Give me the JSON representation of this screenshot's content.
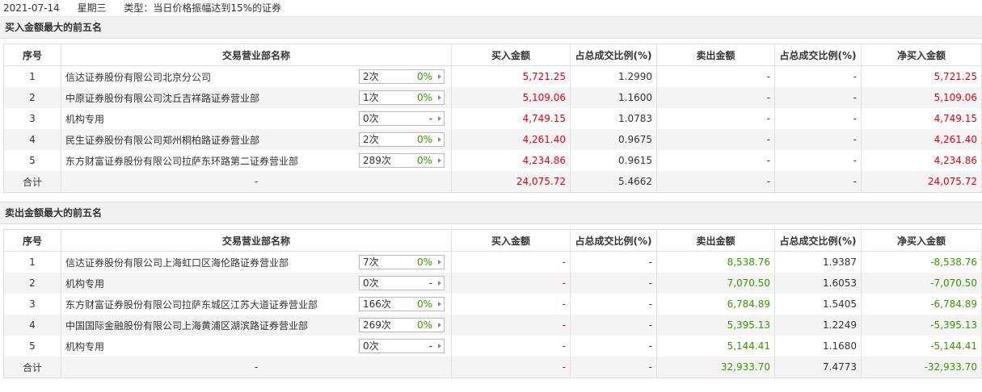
{
  "header": {
    "date": "2021-07-14",
    "weekday": "星期三",
    "type_text": "类型：当日价格振幅达到15%的证券"
  },
  "columns": [
    "序号",
    "交易营业部名称",
    "买入金额",
    "占总成交比例(%)",
    "卖出金额",
    "占总成交比例(%)",
    "净买入金额"
  ],
  "colors": {
    "up": "#e60012",
    "down": "#339900",
    "section_bg": "#f1f1f1",
    "stripe": "#f4f4f4"
  },
  "buy_section": {
    "title": "买入金额最大的前五名",
    "rows": [
      {
        "no": "1",
        "name": "信达证券股份有限公司北京分公司",
        "count": "2次",
        "pct": "0%",
        "buy": "5,721.25",
        "buy_ratio": "1.2990",
        "sell": "-",
        "sell_ratio": "-",
        "net": "5,721.25"
      },
      {
        "no": "2",
        "name": "中原证券股份有限公司沈丘吉祥路证券营业部",
        "count": "1次",
        "pct": "0%",
        "buy": "5,109.06",
        "buy_ratio": "1.1600",
        "sell": "-",
        "sell_ratio": "-",
        "net": "5,109.06"
      },
      {
        "no": "3",
        "name": "机构专用",
        "count": "0次",
        "pct": "-",
        "buy": "4,749.15",
        "buy_ratio": "1.0783",
        "sell": "-",
        "sell_ratio": "-",
        "net": "4,749.15"
      },
      {
        "no": "4",
        "name": "民生证券股份有限公司郑州桐柏路证券营业部",
        "count": "2次",
        "pct": "0%",
        "buy": "4,261.40",
        "buy_ratio": "0.9675",
        "sell": "-",
        "sell_ratio": "-",
        "net": "4,261.40"
      },
      {
        "no": "5",
        "name": "东方财富证券股份有限公司拉萨东环路第二证券营业部",
        "count": "289次",
        "pct": "0%",
        "buy": "4,234.86",
        "buy_ratio": "0.9615",
        "sell": "-",
        "sell_ratio": "-",
        "net": "4,234.86"
      }
    ],
    "total": {
      "label": "合计",
      "name": "-",
      "buy": "24,075.72",
      "buy_ratio": "5.4662",
      "sell": "-",
      "sell_ratio": "-",
      "net": "24,075.72"
    }
  },
  "sell_section": {
    "title": "卖出金额最大的前五名",
    "rows": [
      {
        "no": "1",
        "name": "信达证券股份有限公司上海虹口区海伦路证券营业部",
        "count": "7次",
        "pct": "0%",
        "buy": "-",
        "buy_ratio": "-",
        "sell": "8,538.76",
        "sell_ratio": "1.9387",
        "net": "-8,538.76"
      },
      {
        "no": "2",
        "name": "机构专用",
        "count": "0次",
        "pct": "-",
        "buy": "-",
        "buy_ratio": "-",
        "sell": "7,070.50",
        "sell_ratio": "1.6053",
        "net": "-7,070.50"
      },
      {
        "no": "3",
        "name": "东方财富证券股份有限公司拉萨东城区江苏大道证券营业部",
        "count": "166次",
        "pct": "0%",
        "buy": "-",
        "buy_ratio": "-",
        "sell": "6,784.89",
        "sell_ratio": "1.5405",
        "net": "-6,784.89"
      },
      {
        "no": "4",
        "name": "中国国际金融股份有限公司上海黄浦区湖滨路证券营业部",
        "count": "269次",
        "pct": "0%",
        "buy": "-",
        "buy_ratio": "-",
        "sell": "5,395.13",
        "sell_ratio": "1.2249",
        "net": "-5,395.13"
      },
      {
        "no": "5",
        "name": "机构专用",
        "count": "0次",
        "pct": "-",
        "buy": "-",
        "buy_ratio": "-",
        "sell": "5,144.41",
        "sell_ratio": "1.1680",
        "net": "-5,144.41"
      }
    ],
    "total": {
      "label": "合计",
      "name": "-",
      "buy": "-",
      "buy_ratio": "-",
      "sell": "32,933.70",
      "sell_ratio": "7.4773",
      "net": "-32,933.70"
    }
  }
}
